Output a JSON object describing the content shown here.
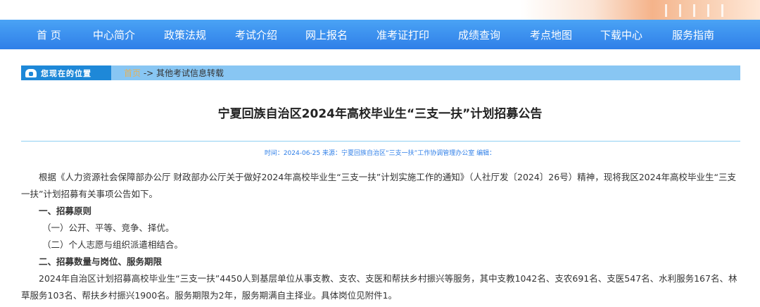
{
  "nav": {
    "items": [
      "首  页",
      "中心简介",
      "政策法规",
      "考试介绍",
      "网上报名",
      "准考证打印",
      "成绩查询",
      "考点地图",
      "下载中心",
      "服务指南"
    ],
    "colors": {
      "bar": "#2f7fe8",
      "text": "#ffffff"
    }
  },
  "breadcrumb": {
    "label": "您现在的位置",
    "home": "首页",
    "sep": " -> ",
    "current": "其他考试信息转载"
  },
  "article": {
    "title": "宁夏回族自治区2024年高校毕业生“三支一扶”计划招募公告",
    "meta": "时间：2024-06-25  来源：宁夏回族自治区“三支一扶”工作协调管理办公室  编辑：",
    "para1": "根据《人力资源社会保障部办公厅 财政部办公厅关于做好2024年高校毕业生“三支一扶”计划实施工作的通知》（人社厅发〔2024〕26号）精神，现将我区2024年高校毕业生“三支一扶”计划招募有关事项公告如下。",
    "h1": "一、招募原则",
    "item1": "（一）公开、平等、竞争、择优。",
    "item2": "（二）个人志愿与组织派遣相结合。",
    "h2": "二、招募数量与岗位、服务期限",
    "para2": "2024年自治区计划招募高校毕业生“三支一扶”4450人到基层单位从事支教、支农、支医和帮扶乡村振兴等服务，其中支教1042名、支农691名、支医547名、水利服务167名、林草服务103名、帮扶乡村振兴1900名。服务期限为2年，服务期满自主择业。具体岗位见附件1。"
  }
}
